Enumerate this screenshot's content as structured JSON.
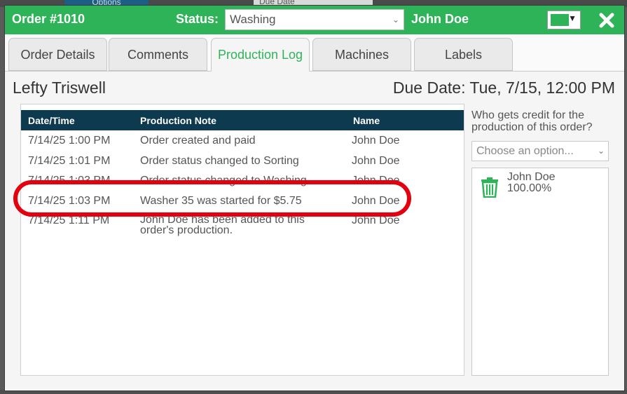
{
  "background": {
    "options_label": "Options",
    "date_select": "Due Date"
  },
  "header": {
    "order_title": "Order #1010",
    "status_label": "Status:",
    "status_value": "Washing",
    "user_name": "John Doe",
    "accent_color": "#2fb358"
  },
  "tabs": [
    {
      "label": "Order Details"
    },
    {
      "label": "Comments"
    },
    {
      "label": "Production Log",
      "active": true
    },
    {
      "label": "Machines"
    },
    {
      "label": "Labels"
    }
  ],
  "customer_name": "Lefty Triswell",
  "due_date": "Due Date: Tue, 7/15, 12:00 PM",
  "log": {
    "columns": {
      "datetime": "Date/Time",
      "note": "Production Note",
      "name": "Name"
    },
    "rows": [
      {
        "datetime": "7/14/25 1:00 PM",
        "note": "Order created and paid",
        "name": "John Doe"
      },
      {
        "datetime": "7/14/25 1:01 PM",
        "note": "Order status changed to Sorting",
        "name": "John Doe"
      },
      {
        "datetime": "7/14/25 1:03 PM",
        "note": "Order status changed to Washing",
        "name": "John Doe"
      },
      {
        "datetime": "7/14/25 1:03 PM",
        "note": "Washer 35 was started for $5.75",
        "name": "John Doe"
      },
      {
        "datetime": "7/14/25 1:11 PM",
        "note": "John Doe has been added to this order's production.",
        "name": "John Doe"
      }
    ],
    "highlight_color": "#e3000f"
  },
  "credit": {
    "question": "Who gets credit for the production of this order?",
    "placeholder": "Choose an option...",
    "assignee_name": "John Doe",
    "assignee_percent": "100.00%"
  }
}
